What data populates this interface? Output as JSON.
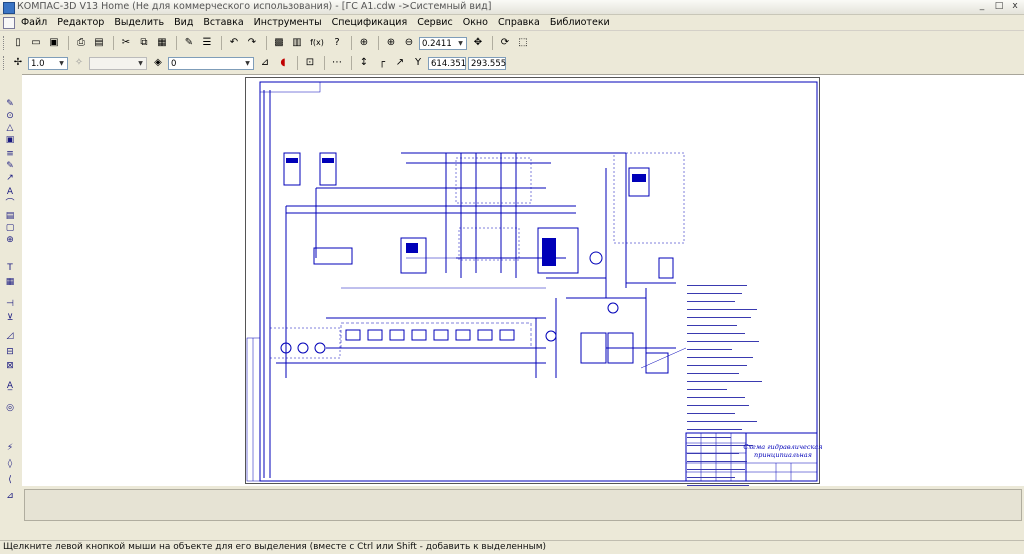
{
  "window": {
    "title": "КОМПАС-3D V13 Home (Не для коммерческого использования) - [ГС А1.cdw ->Системный вид]",
    "minimize_glyph": "_",
    "maximize_glyph": "□",
    "close_glyph": "x"
  },
  "menu": [
    "Файл",
    "Редактор",
    "Выделить",
    "Вид",
    "Вставка",
    "Инструменты",
    "Спецификация",
    "Сервис",
    "Окно",
    "Справка",
    "Библиотеки"
  ],
  "toolbar1": {
    "icons": [
      {
        "name": "new-document-icon",
        "glyph": "▯"
      },
      {
        "name": "open-icon",
        "glyph": "▭"
      },
      {
        "name": "save-icon",
        "glyph": "▣"
      },
      {
        "name": "print-icon",
        "glyph": "⎙"
      },
      {
        "name": "print-preview-icon",
        "glyph": "▤"
      },
      {
        "name": "cut-icon",
        "glyph": "✂"
      },
      {
        "name": "copy-icon",
        "glyph": "⧉"
      },
      {
        "name": "paste-icon",
        "glyph": "▦"
      },
      {
        "name": "format-brush-icon",
        "glyph": "✎"
      },
      {
        "name": "properties-icon",
        "glyph": "☰"
      },
      {
        "name": "undo-icon",
        "glyph": "↶"
      },
      {
        "name": "redo-icon",
        "glyph": "↷"
      },
      {
        "name": "manager-icon",
        "glyph": "▩"
      },
      {
        "name": "layers-icon",
        "glyph": "▥"
      },
      {
        "name": "variables-icon",
        "glyph": "f(x)"
      },
      {
        "name": "help-cursor-icon",
        "glyph": "?"
      },
      {
        "name": "zoom-window-icon",
        "glyph": "⊕"
      },
      {
        "name": "zoom-in-icon",
        "glyph": "⊕"
      },
      {
        "name": "zoom-out-icon",
        "glyph": "⊖"
      },
      {
        "name": "pan-icon",
        "glyph": "✥"
      },
      {
        "name": "refresh-icon",
        "glyph": "⟳"
      },
      {
        "name": "show-all-icon",
        "glyph": "⬚"
      }
    ],
    "zoom_value": "0.2411"
  },
  "toolbar2": {
    "snap_icon": "✢",
    "line_scale": "1.0",
    "view_icon": "✧",
    "view_combo": "",
    "layer_icon": "◈",
    "layer_value": "0",
    "snap_btn1": "⊿",
    "snap_btn2": "⊡",
    "snap_btn3": "⋯",
    "ortho_icon": "↕",
    "grid_icon": "┌",
    "magnet_icon": "◖",
    "local_cs_icon": "↗",
    "coords_icon": "Y",
    "coord_x": "614.351",
    "coord_y": "293.555"
  },
  "left_tools": [
    "✎",
    "⊙",
    "△",
    "▣",
    "≡",
    "✎",
    "↗",
    "A",
    "⌒",
    "▤",
    "▢",
    "⊕",
    "T",
    "▦",
    "⊣",
    "⊻",
    "◿",
    "⊟",
    "⊠",
    "A̲",
    "◎",
    "⚡",
    "◊",
    "⟨",
    "⊿"
  ],
  "drawing": {
    "stamp_title": "Схема гидравлическая принципиальная"
  },
  "status": {
    "text": "Щелкните левой кнопкой мыши на объекте для его выделения (вместе с Ctrl или Shift - добавить к выделенным)"
  },
  "colors": {
    "drawing_blue": "#0000b8",
    "workspace": "#ffffff",
    "chrome": "#ece9d8"
  }
}
